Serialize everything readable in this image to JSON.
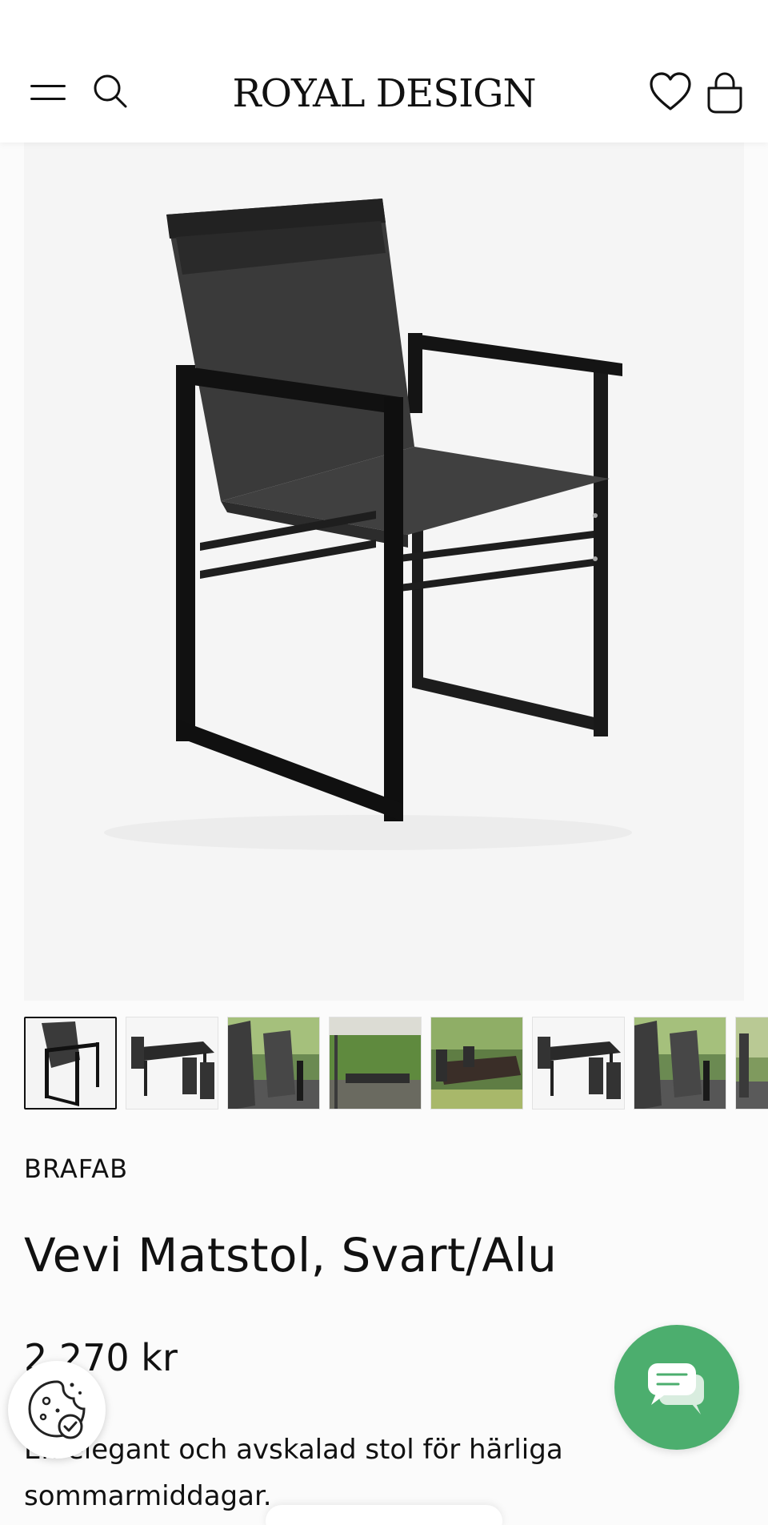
{
  "header": {
    "logo": "ROYAL DESIGN",
    "icons": [
      "menu-icon",
      "search-icon",
      "heart-icon",
      "shopping-bag-icon"
    ]
  },
  "gallery": {
    "main_image": "black aluminium outdoor dining chair with grey mesh seat",
    "thumbnail_count": 8,
    "active_index": 0
  },
  "product": {
    "brand": "BRAFAB",
    "title": "Vevi Matstol, Svart/Alu",
    "price": "2 270 kr",
    "description": "En elegant och avskalad stol för härliga sommarmiddagar."
  },
  "floating": {
    "chat_icon": "chat-bubbles-icon",
    "cookie_icon": "cookie-settings-icon"
  },
  "colors": {
    "accent_green": "#4cae6e",
    "text": "#111111",
    "background": "#fbfbfb"
  }
}
